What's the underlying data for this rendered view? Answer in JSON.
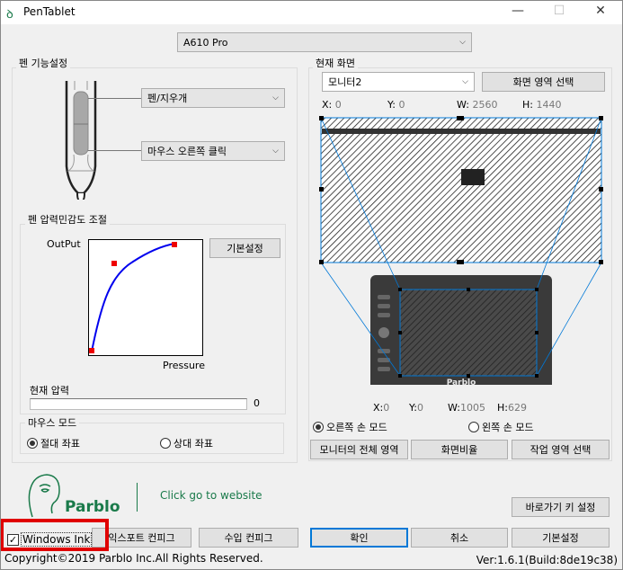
{
  "window": {
    "title": "PenTablet",
    "minimize": "—",
    "maximize": "☐",
    "close": "✕"
  },
  "device": {
    "selected": "A610 Pro"
  },
  "pen_settings": {
    "label": "펜 기능설정",
    "upper_button": "펜/지우개",
    "lower_button": "마우스 오른쪽 클릭"
  },
  "pressure": {
    "label": "펜 압력민감도 조절",
    "output_label": "OutPut",
    "pressure_label": "Pressure",
    "default_button": "기본설정",
    "current_label": "현재 압력",
    "current_value": "0",
    "current_fraction": 0
  },
  "mouse_mode": {
    "label": "마우스 모드",
    "absolute": "절대 좌표",
    "relative": "상대 좌표",
    "selected": "absolute"
  },
  "screen": {
    "label": "현재 화면",
    "monitor": "모니터2",
    "select_area_button": "화면 영역 선택",
    "x_label": "X:",
    "x": "0",
    "y_label": "Y:",
    "y": "0",
    "w_label": "W:",
    "w": "2560",
    "h_label": "H:",
    "h": "1440"
  },
  "tablet": {
    "brand": "Parblo",
    "x_label": "X:",
    "x": "0",
    "y_label": "Y:",
    "y": "0",
    "w_label": "W:",
    "w": "1005",
    "h_label": "H:",
    "h": "629",
    "right_hand": "오른쪽 손 모드",
    "left_hand": "왼쪽 손 모드",
    "selected_hand": "right",
    "full_area_button": "모니터의 전체 영역",
    "ratio_button": "화면비율",
    "work_area_button": "작업 영역 선택"
  },
  "branding": {
    "logo_text": "Parblo",
    "website_link": "Click go to website"
  },
  "shortcut_button": "바로가기 키 설정",
  "bottom": {
    "windows_ink": "Windows Ink",
    "windows_ink_checked": true,
    "export_button": "익스포트 컨피그",
    "import_button": "수입 컨피그",
    "ok_button": "확인",
    "cancel_button": "취소",
    "default_button": "기본설정"
  },
  "footer": {
    "copyright": "Copyright©2019  Parblo Inc.All Rights Reserved.",
    "version": "Ver:1.6.1(Build:8de19c38)"
  },
  "colors": {
    "accent": "#0078d7",
    "brand_green": "#1a7a4a",
    "highlight_red": "#e00000"
  }
}
